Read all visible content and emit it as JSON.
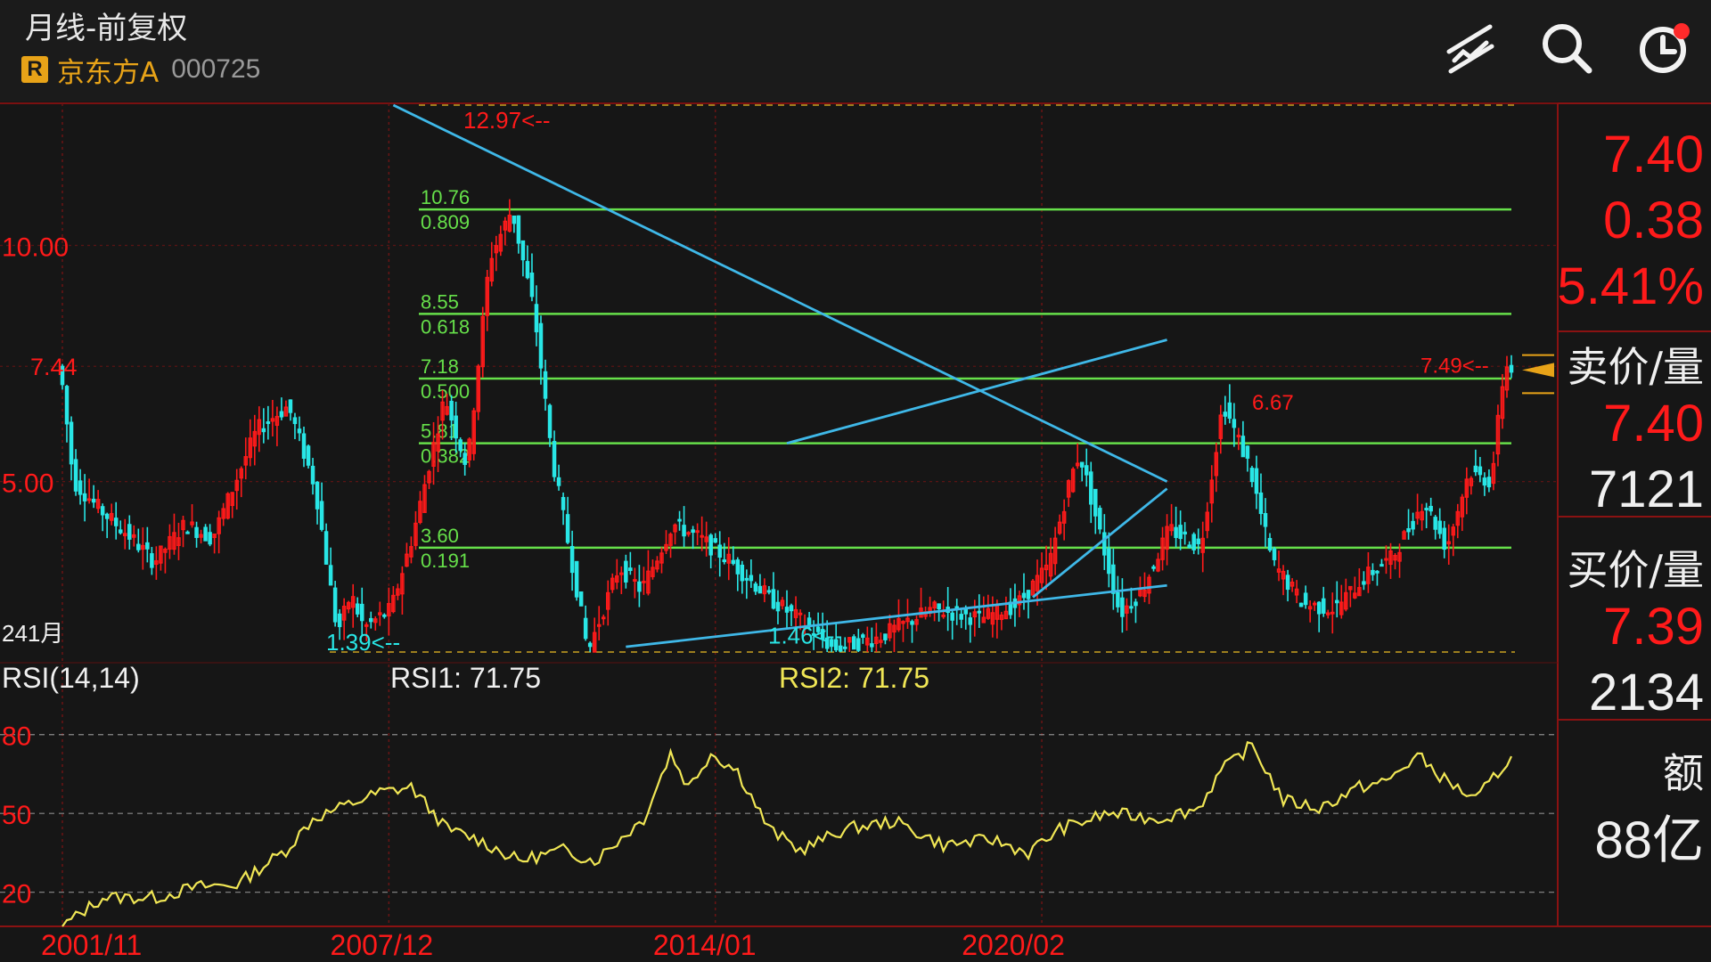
{
  "header": {
    "title": "月线-前复权",
    "badge": "R",
    "stock_name": "京东方A",
    "stock_code": "000725"
  },
  "quote_panel": {
    "price": "7.40",
    "change": "0.38",
    "change_pct": "5.41%",
    "ask_label": "卖价/量",
    "ask_price": "7.40",
    "ask_volume": "7121",
    "bid_label": "买价/量",
    "bid_price": "7.39",
    "bid_volume": "2134",
    "amount_label": "额",
    "amount_value": "88亿"
  },
  "colors": {
    "up": "#ff1a1a",
    "down": "#29e6e6",
    "fib_line": "#66e04a",
    "trend_line": "#3fb8e8",
    "rsi_line": "#f0e655",
    "accent": "#e8a318"
  },
  "chart_data": [
    {
      "type": "candlestick",
      "title": "月线-前复权",
      "period_label": "241月",
      "ylim": [
        1.39,
        12.97
      ],
      "y_ticks": [
        "10.00",
        "7.44",
        "5.00"
      ],
      "x_tick_labels": [
        "2001/11",
        "2007/12",
        "2014/01",
        "2020/02"
      ],
      "annotations": {
        "high": "12.97<--",
        "low1": "1.39<--",
        "low2": "1.46<--",
        "peak2": "6.67",
        "recent_high": "7.49<--"
      },
      "fib_levels": [
        {
          "price": "10.76",
          "ratio": "0.809",
          "value": 10.76
        },
        {
          "price": "8.55",
          "ratio": "0.618",
          "value": 8.55
        },
        {
          "price": "7.18",
          "ratio": "0.500",
          "value": 7.18
        },
        {
          "price": "5.81",
          "ratio": "0.382",
          "value": 5.81
        },
        {
          "price": "3.60",
          "ratio": "0.191",
          "value": 3.6
        }
      ],
      "trend_lines": [
        {
          "x": [
            "2008-01",
            "2022-06"
          ],
          "y": [
            12.97,
            5.0
          ]
        },
        {
          "x": [
            "2015-05",
            "2022-06"
          ],
          "y": [
            5.81,
            8.0
          ]
        },
        {
          "x": [
            "2012-05",
            "2022-06"
          ],
          "y": [
            1.5,
            2.8
          ]
        },
        {
          "x": [
            "2019-12",
            "2022-06"
          ],
          "y": [
            2.55,
            4.85
          ]
        }
      ],
      "price_path": [
        [
          "2001-11",
          7.44
        ],
        [
          "2002-02",
          5.0
        ],
        [
          "2002-08",
          4.4
        ],
        [
          "2003-03",
          3.8
        ],
        [
          "2003-08",
          3.3
        ],
        [
          "2004-03",
          4.1
        ],
        [
          "2004-09",
          3.8
        ],
        [
          "2005-07",
          6.1
        ],
        [
          "2006-02",
          6.6
        ],
        [
          "2006-08",
          4.9
        ],
        [
          "2007-01",
          1.8
        ],
        [
          "2007-04",
          2.6
        ],
        [
          "2007-07",
          1.9
        ],
        [
          "2008-01",
          2.3
        ],
        [
          "2008-06",
          3.9
        ],
        [
          "2009-01",
          6.8
        ],
        [
          "2009-06",
          5.3
        ],
        [
          "2009-11",
          9.7
        ],
        [
          "2010-04",
          10.76
        ],
        [
          "2010-09",
          8.6
        ],
        [
          "2011-01",
          5.5
        ],
        [
          "2011-06",
          3.0
        ],
        [
          "2011-09",
          1.39
        ],
        [
          "2012-04",
          3.2
        ],
        [
          "2012-09",
          2.7
        ],
        [
          "2013-04",
          4.1
        ],
        [
          "2013-10",
          3.8
        ],
        [
          "2014-05",
          3.3
        ],
        [
          "2015-02",
          2.5
        ],
        [
          "2015-08",
          2.1
        ],
        [
          "2016-04",
          1.46
        ],
        [
          "2017-02",
          1.7
        ],
        [
          "2018-02",
          2.3
        ],
        [
          "2019-01",
          2.1
        ],
        [
          "2019-09",
          2.4
        ],
        [
          "2020-04",
          3.2
        ],
        [
          "2020-09",
          5.1
        ],
        [
          "2020-11",
          5.6
        ],
        [
          "2021-03",
          4.1
        ],
        [
          "2021-08",
          2.2
        ],
        [
          "2022-01",
          2.7
        ],
        [
          "2022-07",
          4.0
        ],
        [
          "2023-02",
          3.6
        ],
        [
          "2023-07",
          6.67
        ],
        [
          "2024-01",
          5.3
        ],
        [
          "2024-06",
          3.3
        ],
        [
          "2025-01",
          2.4
        ],
        [
          "2025-08",
          2.3
        ],
        [
          "2026-03",
          3.0
        ],
        [
          "2026-09",
          3.4
        ],
        [
          "2027-04",
          4.6
        ],
        [
          "2027-09",
          3.6
        ],
        [
          "2028-02",
          5.2
        ],
        [
          "2028-07",
          5.0
        ],
        [
          "2028-10",
          7.49
        ],
        [
          "2028-11",
          7.4
        ]
      ]
    },
    {
      "type": "line",
      "title": "RSI(14,14)",
      "series": [
        {
          "name": "RSI1: 71.75",
          "values": [
            71.75
          ]
        },
        {
          "name": "RSI2: 71.75",
          "values": [
            71.75
          ]
        }
      ],
      "y_ticks": [
        "80",
        "50",
        "20"
      ],
      "ylim": [
        7,
        85
      ],
      "rsi_path": [
        [
          "2001-11",
          7
        ],
        [
          "2002-08",
          18
        ],
        [
          "2003-08",
          18
        ],
        [
          "2004-05",
          22
        ],
        [
          "2005-02",
          23
        ],
        [
          "2006-01",
          36
        ],
        [
          "2006-07",
          48
        ],
        [
          "2007-10",
          58
        ],
        [
          "2008-05",
          60
        ],
        [
          "2009-01",
          44
        ],
        [
          "2009-08",
          40
        ],
        [
          "2010-05",
          32
        ],
        [
          "2011-03",
          36
        ],
        [
          "2011-10",
          32
        ],
        [
          "2012-09",
          48
        ],
        [
          "2013-03",
          73
        ],
        [
          "2013-07",
          60
        ],
        [
          "2013-12",
          73
        ],
        [
          "2014-06",
          66
        ],
        [
          "2015-01",
          44
        ],
        [
          "2015-08",
          36
        ],
        [
          "2016-06",
          44
        ],
        [
          "2017-05",
          47
        ],
        [
          "2018-04",
          38
        ],
        [
          "2019-03",
          40
        ],
        [
          "2019-11",
          35
        ],
        [
          "2020-06",
          44
        ],
        [
          "2021-05",
          50
        ],
        [
          "2022-04",
          48
        ],
        [
          "2023-01",
          52
        ],
        [
          "2023-06",
          66
        ],
        [
          "2024-01",
          76
        ],
        [
          "2024-08",
          55
        ],
        [
          "2025-04",
          52
        ],
        [
          "2026-01",
          60
        ],
        [
          "2026-07",
          62
        ],
        [
          "2027-02",
          72
        ],
        [
          "2027-08",
          63
        ],
        [
          "2028-03",
          55
        ],
        [
          "2028-11",
          71.75
        ]
      ]
    }
  ]
}
